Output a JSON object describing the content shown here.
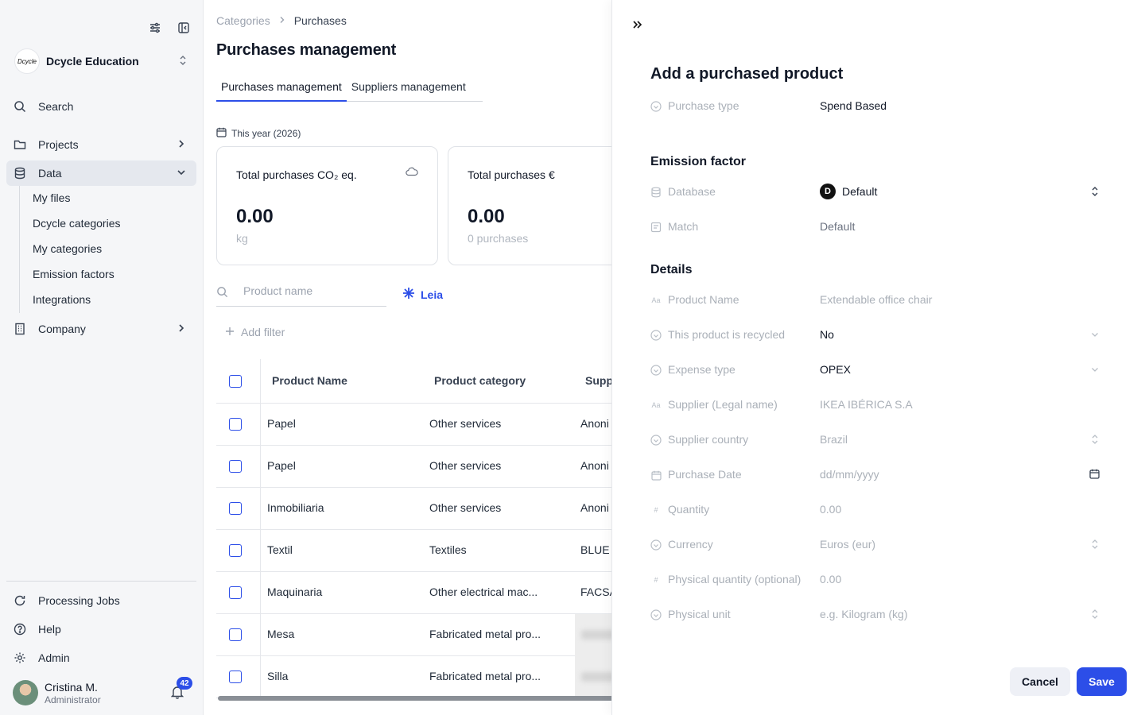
{
  "sidebar": {
    "org": {
      "logo_text": "Dcycle",
      "name": "Dcycle Education"
    },
    "search_label": "Search",
    "nav": {
      "projects": "Projects",
      "data": "Data",
      "company": "Company"
    },
    "data_sub": [
      "My files",
      "Dcycle categories",
      "My categories",
      "Emission factors",
      "Integrations"
    ],
    "bottom": {
      "processing": "Processing Jobs",
      "help": "Help",
      "admin": "Admin"
    },
    "user": {
      "name": "Cristina M.",
      "role": "Administrator",
      "notifications": "42"
    }
  },
  "main": {
    "breadcrumb": {
      "parent": "Categories",
      "current": "Purchases"
    },
    "title": "Purchases management",
    "tabs": [
      "Purchases management",
      "Suppliers management"
    ],
    "period": "This year (2026)",
    "kpis": [
      {
        "title": "Total purchases CO₂ eq.",
        "value": "0.00",
        "unit": "kg"
      },
      {
        "title": "Total purchases €",
        "value": "0.00",
        "unit": "0 purchases"
      }
    ],
    "search_placeholder": "Product name",
    "leia": "Leia",
    "add_filter": "Add filter",
    "table": {
      "headers": [
        "Product Name",
        "Product category",
        "Supp"
      ],
      "rows": [
        [
          "Papel",
          "Other services",
          "Anoni"
        ],
        [
          "Papel",
          "Other services",
          "Anoni"
        ],
        [
          "Inmobiliaria",
          "Other services",
          "Anoni"
        ],
        [
          "Textil",
          "Textiles",
          "BLUE"
        ],
        [
          "Maquinaria",
          "Other electrical mac...",
          "FACSA"
        ],
        [
          "Mesa",
          "Fabricated metal pro...",
          ""
        ],
        [
          "Silla",
          "Fabricated metal pro...",
          ""
        ]
      ]
    }
  },
  "drawer": {
    "title": "Add a purchased product",
    "purchase_type": {
      "label": "Purchase type",
      "value": "Spend Based"
    },
    "emission_factor": {
      "heading": "Emission factor",
      "database": {
        "label": "Database",
        "value": "Default",
        "logo": "D"
      },
      "match": {
        "label": "Match",
        "value": "Default"
      }
    },
    "details": {
      "heading": "Details",
      "product_name": {
        "label": "Product Name",
        "placeholder": "Extendable office chair"
      },
      "recycled": {
        "label": "This product is recycled",
        "value": "No"
      },
      "expense_type": {
        "label": "Expense type",
        "value": "OPEX"
      },
      "supplier": {
        "label": "Supplier (Legal name)",
        "placeholder": "IKEA IBÉRICA S.A"
      },
      "supplier_country": {
        "label": "Supplier country",
        "placeholder": "Brazil"
      },
      "purchase_date": {
        "label": "Purchase Date",
        "placeholder": "dd/mm/yyyy"
      },
      "quantity": {
        "label": "Quantity",
        "placeholder": "0.00"
      },
      "currency": {
        "label": "Currency",
        "placeholder": "Euros (eur)"
      },
      "physical_quantity": {
        "label": "Physical quantity (optional)",
        "placeholder": "0.00"
      },
      "physical_unit": {
        "label": "Physical unit",
        "placeholder": "e.g. Kilogram (kg)"
      }
    },
    "actions": {
      "cancel": "Cancel",
      "save": "Save"
    }
  },
  "colors": {
    "accent": "#2c4ee8",
    "sidebar_bg": "#f5f6f8",
    "active_item": "#e5e8ee"
  },
  "icons": [
    "sliders-icon",
    "collapse-sidebar-icon",
    "search-icon",
    "folder-icon",
    "database-icon",
    "building-icon",
    "refresh-icon",
    "help-circle-icon",
    "gear-icon",
    "bell-icon",
    "calendar-icon",
    "cloud-icon",
    "plus-icon",
    "leia-star-icon",
    "double-chevron-right-icon"
  ]
}
